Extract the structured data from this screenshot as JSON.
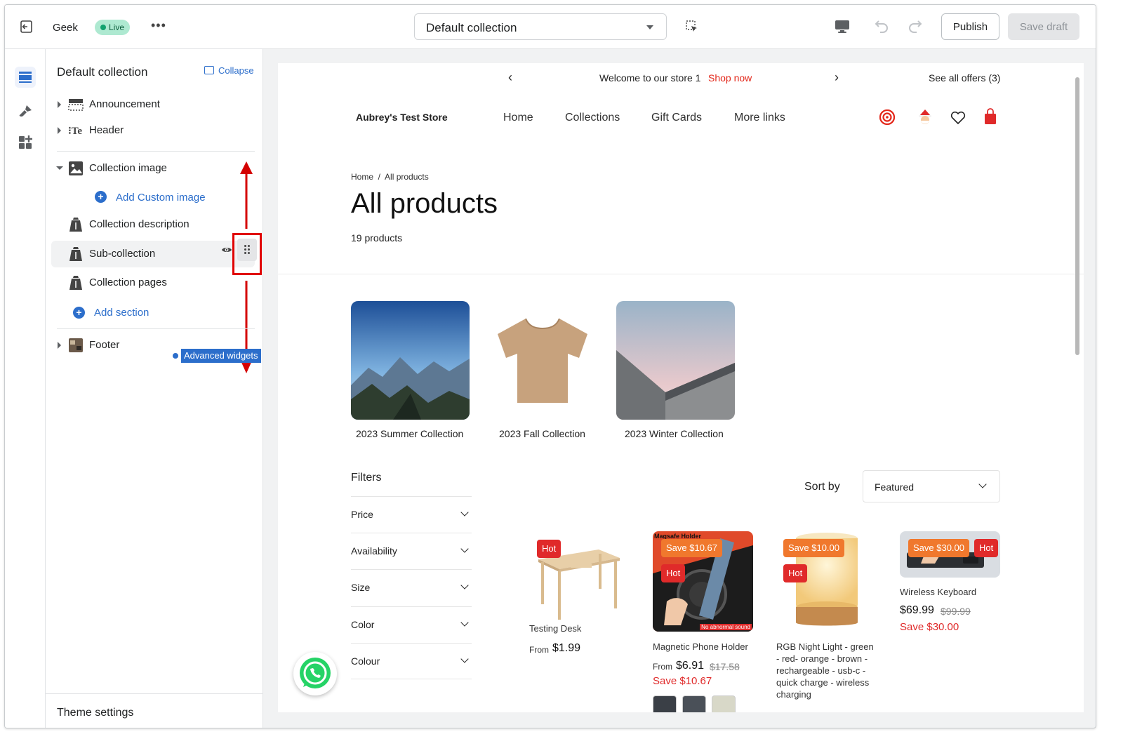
{
  "topbar": {
    "store_name": "Geek",
    "status": "Live",
    "more": "•••",
    "template_select": "Default collection",
    "publish_label": "Publish",
    "save_draft_label": "Save draft"
  },
  "panel": {
    "title": "Default collection",
    "collapse_label": "Collapse",
    "items": {
      "announcement": "Announcement",
      "header": "Header",
      "collection_image": "Collection image",
      "add_custom_image": "Add Custom image",
      "collection_description": "Collection description",
      "sub_collection": "Sub-collection",
      "collection_pages": "Collection pages",
      "add_section": "Add section",
      "advanced_widgets": "Advanced widgets",
      "footer": "Footer"
    },
    "header_icon_text": "Te",
    "theme_settings": "Theme settings"
  },
  "preview": {
    "announcement": {
      "text": "Welcome to our store 1",
      "link": "Shop now",
      "offers": "See all offers (3)"
    },
    "store_name": "Aubrey's Test Store",
    "nav": [
      "Home",
      "Collections",
      "Gift Cards",
      "More links"
    ],
    "breadcrumb": "Home  /  All products",
    "page_title": "All products",
    "product_count": "19 products",
    "collections": [
      "2023 Summer Collection",
      "2023 Fall Collection",
      "2023 Winter Collection"
    ],
    "filters": {
      "heading": "Filters",
      "items": [
        "Price",
        "Availability",
        "Size",
        "Color",
        "Colour"
      ]
    },
    "sort": {
      "label": "Sort by",
      "value": "Featured"
    },
    "products": [
      {
        "name": "Testing Desk",
        "from": "From",
        "price": "$1.99",
        "badges": [
          "Hot"
        ]
      },
      {
        "name": "Magnetic Phone Holder",
        "from": "From",
        "price": "$6.91",
        "old_price": "$17.58",
        "save": "Save $10.67",
        "badges": [
          "Save $10.67",
          "Hot"
        ],
        "image_text": "Magsafe Holder",
        "image_text2": "No abnormal sound"
      },
      {
        "name": "RGB Night Light - green - red- orange - brown - rechargeable - usb-c - quick charge - wireless charging",
        "badges": [
          "Save $10.00",
          "Hot"
        ]
      },
      {
        "name": "Wireless Keyboard",
        "price": "$69.99",
        "old_price": "$99.99",
        "save": "Save $30.00",
        "badges": [
          "Save $30.00",
          "Hot"
        ]
      }
    ]
  },
  "colors": {
    "accent_blue": "#2c6ecb",
    "live_green": "#aee9d1",
    "sale_red": "#e02a2a",
    "save_orange": "#f0782d",
    "highlight_red": "#e00000"
  }
}
